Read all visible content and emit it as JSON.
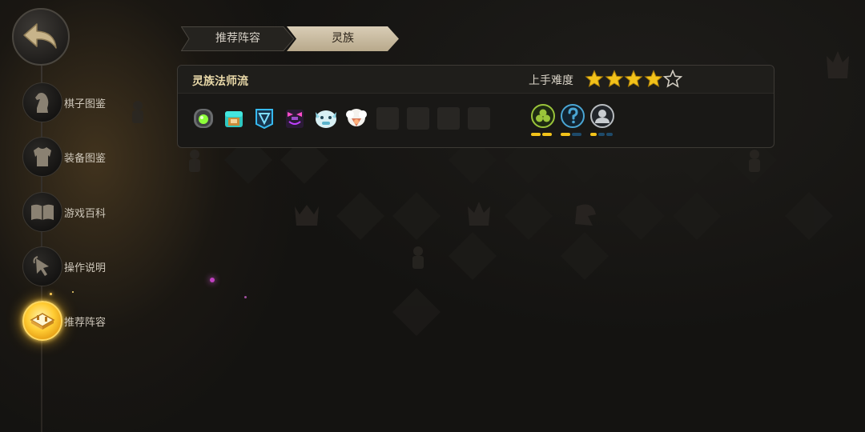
{
  "sidebar": {
    "back_icon": "back-arrow-icon",
    "items": [
      {
        "label": "棋子图鉴",
        "icon": "knight-icon"
      },
      {
        "label": "装备图鉴",
        "icon": "armor-icon"
      },
      {
        "label": "游戏百科",
        "icon": "book-icon"
      },
      {
        "label": "操作说明",
        "icon": "pointer-icon"
      },
      {
        "label": "推荐阵容",
        "icon": "board-icon",
        "active": true
      }
    ]
  },
  "breadcrumb": {
    "tabs": [
      {
        "label": "推荐阵容"
      },
      {
        "label": "灵族"
      }
    ]
  },
  "lineup": {
    "title": "灵族法师流",
    "difficulty_label": "上手难度",
    "difficulty_stars": 4,
    "difficulty_max": 5,
    "champions": [
      {
        "icon": "green-orb-golem-icon"
      },
      {
        "icon": "teal-crate-bot-icon"
      },
      {
        "icon": "blue-triangle-spirit-icon"
      },
      {
        "icon": "purple-demon-mask-icon"
      },
      {
        "icon": "white-ice-beast-icon"
      },
      {
        "icon": "white-sheep-icon"
      },
      {
        "icon": "empty-slot"
      },
      {
        "icon": "empty-slot"
      },
      {
        "icon": "empty-slot"
      },
      {
        "icon": "empty-slot"
      }
    ],
    "traits": [
      {
        "icon": "triple-circle-trait-icon",
        "color": "#9ac43a",
        "active": 2,
        "total": 2
      },
      {
        "icon": "question-trait-icon",
        "color": "#4aa6d4",
        "active": 1,
        "total": 2
      },
      {
        "icon": "person-trait-icon",
        "color": "#b8bcc0",
        "active": 1,
        "total": 3
      }
    ]
  },
  "colors": {
    "accent_gold": "#f2c21a",
    "pip_active": "#f2c21a",
    "pip_inactive": "#1e4a6a"
  }
}
